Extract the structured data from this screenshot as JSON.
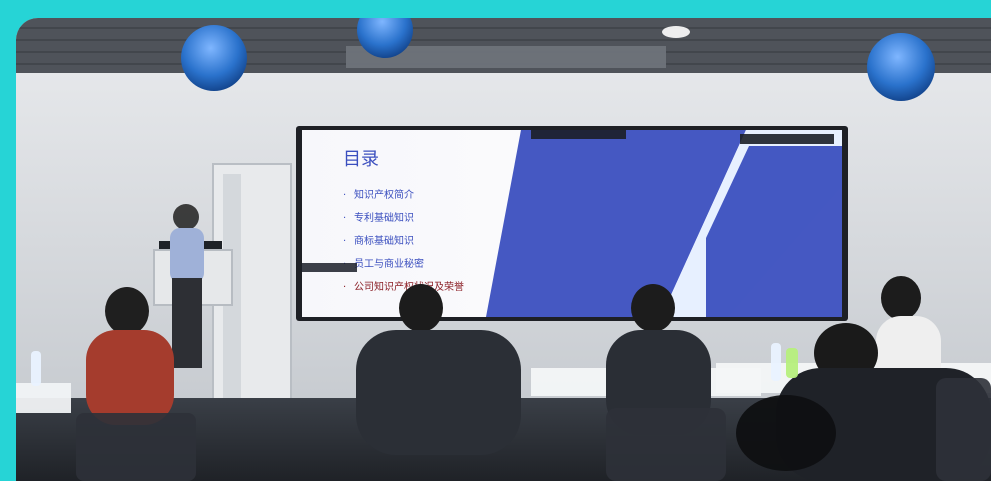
{
  "slide": {
    "title": "目录",
    "items": [
      "知识产权简介",
      "专利基础知识",
      "商标基础知识",
      "员工与商业秘密",
      "公司知识产权状况及荣誉"
    ],
    "bullet": "·"
  },
  "colors": {
    "frame": "#26d4d6",
    "slide_blue": "#3b4fbf",
    "slide_accent": "#e7f0ff",
    "slide_red_text": "#8a1d24"
  }
}
